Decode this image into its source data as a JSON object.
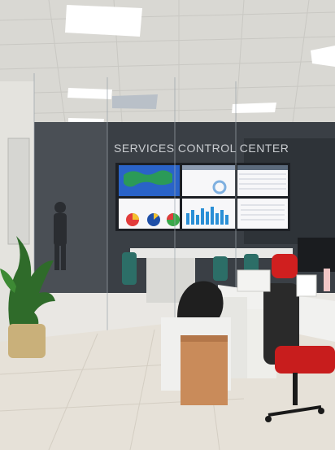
{
  "scene": {
    "description_label": "",
    "sign_text": "SERVICES CONTROL CENTER"
  },
  "colors": {
    "ceiling": "#dcdad6",
    "ceiling_panel": "#f7f7f5",
    "light": "#ffffff",
    "glass_room": "#3a3f45",
    "floor": "#e6e1d8",
    "desk": "#f1f1ef",
    "chair_red": "#d01f1f",
    "chair_dark": "#2a2a2a",
    "box": "#c98b5a",
    "screen_blue": "#2a63c8",
    "screen_white": "#f7f7f9",
    "plant": "#2f6b2a",
    "pot": "#c9b07a"
  },
  "wall": {
    "screens": [
      {
        "name": "map-screen",
        "theme": "map"
      },
      {
        "name": "kpi-screen",
        "theme": "kpi"
      },
      {
        "name": "table-screen",
        "theme": "table"
      },
      {
        "name": "pie-screen",
        "theme": "pie"
      },
      {
        "name": "bar-screen",
        "theme": "bar"
      },
      {
        "name": "text-screen",
        "theme": "text"
      }
    ]
  }
}
